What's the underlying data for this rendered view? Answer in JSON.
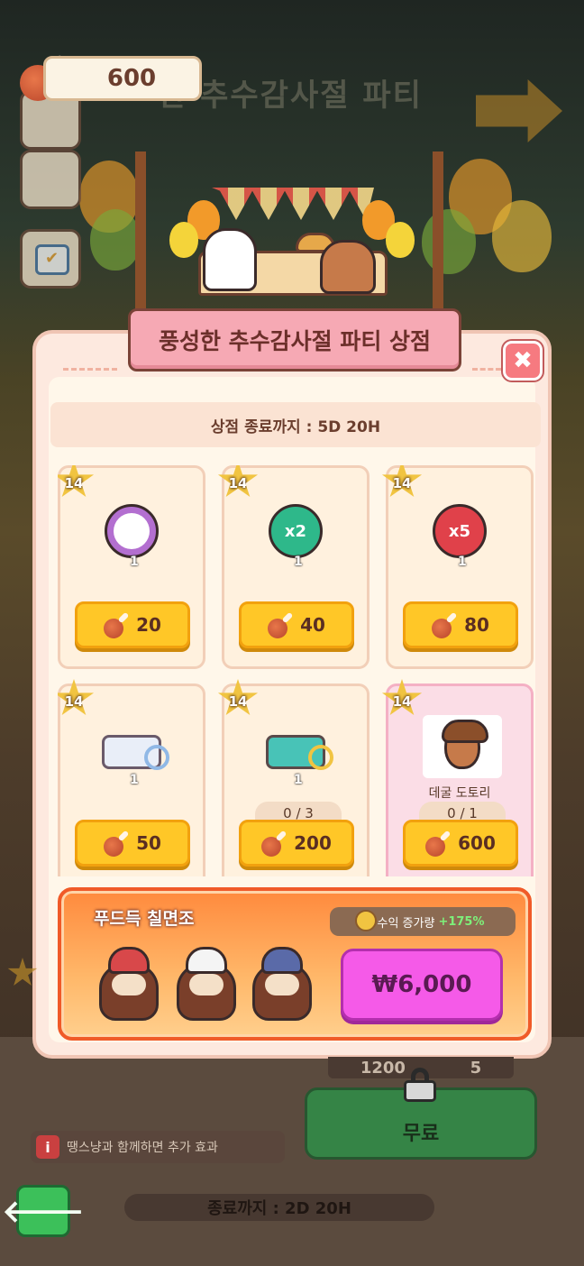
{
  "currency": {
    "amount": "600"
  },
  "background": {
    "event_title": "한 추수감사절 파티"
  },
  "shop": {
    "title": "풍성한 추수감사절 파티 상점",
    "close_label": "✖",
    "timer": "상점 종료까지 : 5D 20H",
    "items": [
      {
        "level": "14",
        "icon": "clock-coin-icon",
        "qty": "1",
        "price": "20",
        "limit": "",
        "name": "",
        "pink": false
      },
      {
        "level": "14",
        "icon": "x2-boost-icon",
        "badge": "x2",
        "qty": "1",
        "price": "40",
        "limit": "",
        "name": "",
        "pink": false
      },
      {
        "level": "14",
        "icon": "x5-boost-icon",
        "badge": "x5",
        "qty": "1",
        "price": "80",
        "limit": "",
        "name": "",
        "pink": false
      },
      {
        "level": "14",
        "icon": "blue-ticket-box-icon",
        "qty": "1",
        "price": "50",
        "limit": "",
        "name": "",
        "pink": false
      },
      {
        "level": "14",
        "icon": "teal-ticket-box-icon",
        "qty": "1",
        "price": "200",
        "limit": "0 / 3",
        "name": "",
        "pink": false
      },
      {
        "level": "14",
        "icon": "acorn-costume-icon",
        "qty": "",
        "price": "600",
        "limit": "0 / 1",
        "name": "데굴 도토리",
        "pink": true
      }
    ]
  },
  "package": {
    "title": "푸드득 칠면조",
    "bonus_label": "수익 증가량",
    "bonus_value": "+175%",
    "price": "₩6,000"
  },
  "background_ui": {
    "locked_values": [
      "1200",
      "5"
    ],
    "free_button": "무료",
    "info_text": "땡스냥과 함께하면 추가 효과",
    "info_icon": "i",
    "back_label": "🡐",
    "event_timer": "종료까지 : 2D 20H"
  }
}
